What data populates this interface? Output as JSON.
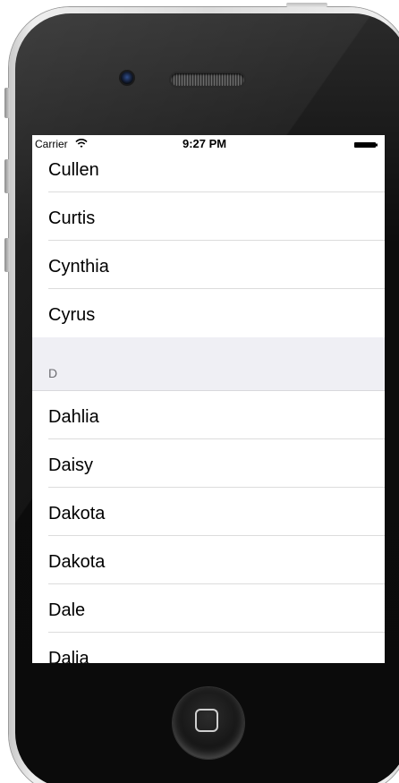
{
  "status_bar": {
    "carrier": "Carrier",
    "time": "9:27 PM",
    "wifi_icon": "wifi-icon",
    "battery_icon": "battery-icon"
  },
  "list": {
    "rows_before": [
      "Cullen",
      "Curtis",
      "Cynthia",
      "Cyrus"
    ],
    "section_header": "D",
    "rows_after": [
      "Dahlia",
      "Daisy",
      "Dakota",
      "Dakota",
      "Dale",
      "Dalia"
    ]
  },
  "device": {
    "home_button_icon": "home-button-square-icon",
    "camera_icon": "front-camera-icon",
    "speaker_icon": "earpiece-speaker-icon"
  },
  "colors": {
    "section_header_bg": "#efeff4",
    "section_header_text": "#6d6d72",
    "separator": "#dcdcdc",
    "device_body": "#0c0c0c"
  }
}
